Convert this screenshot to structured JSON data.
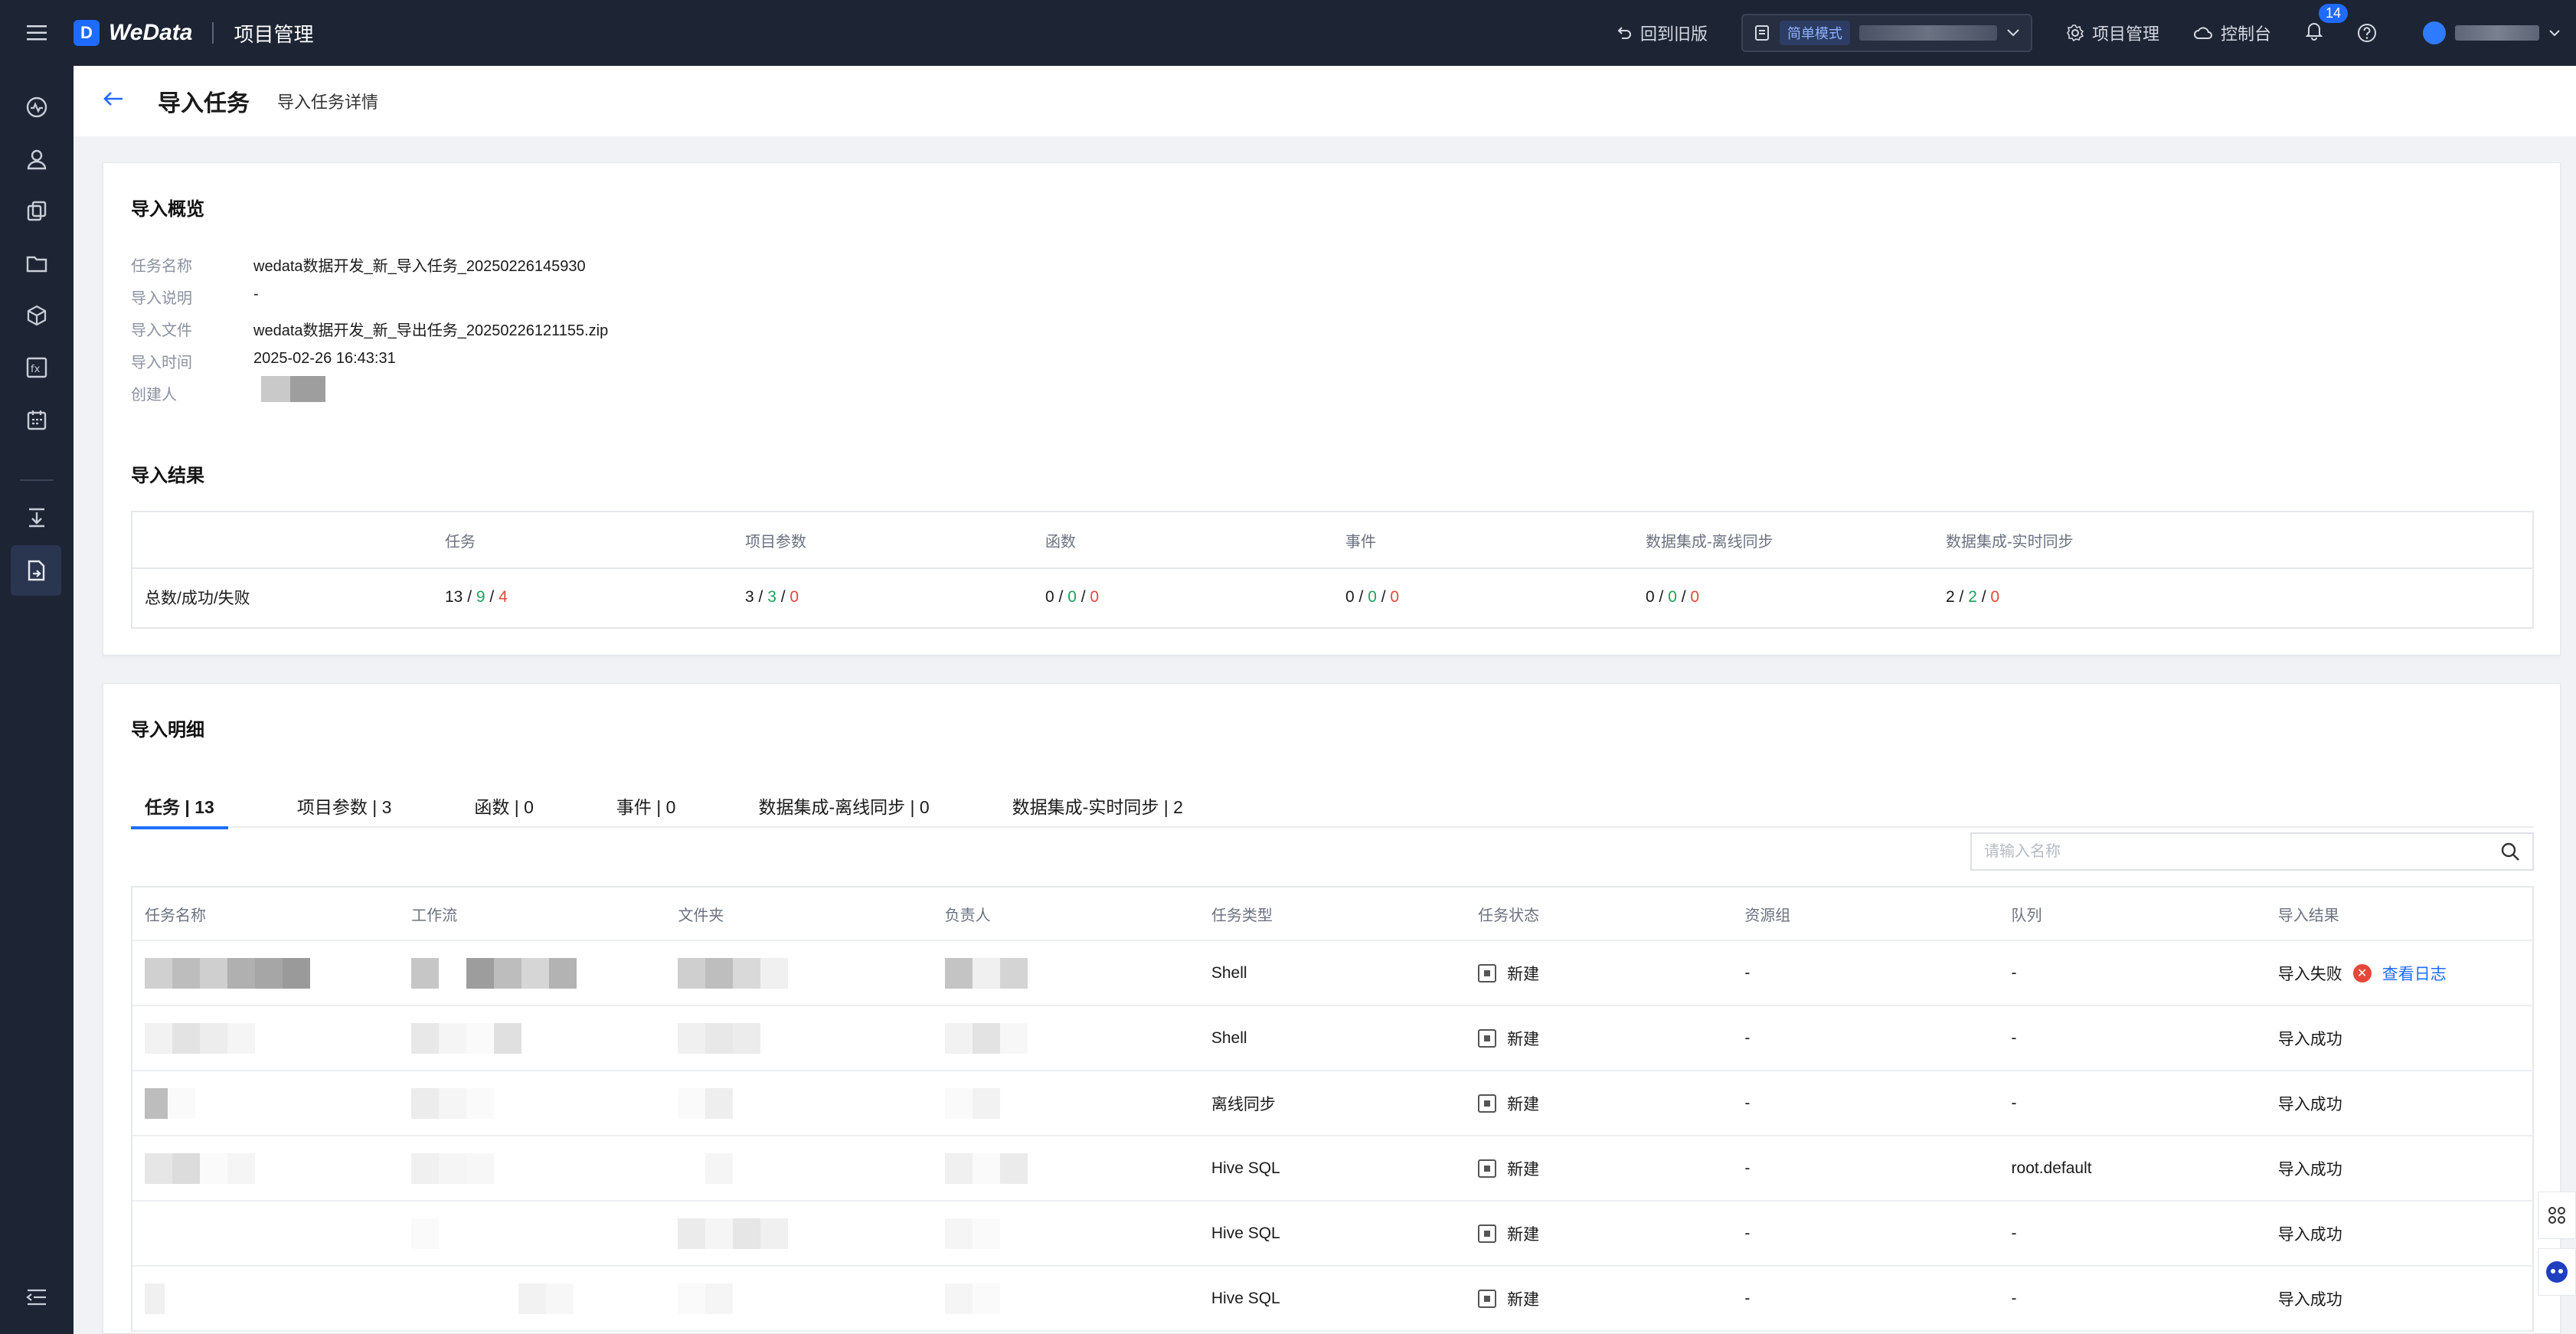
{
  "header": {
    "logo_text": "WeData",
    "logo_sub": "项目管理",
    "back_old": "回到旧版",
    "mode_tag": "简单模式",
    "project_mgmt": "项目管理",
    "console": "控制台",
    "notification_count": "14"
  },
  "page": {
    "title": "导入任务",
    "subtitle": "导入任务详情"
  },
  "overview": {
    "title": "导入概览",
    "fields": [
      {
        "label": "任务名称",
        "value": "wedata数据开发_新_导入任务_20250226145930"
      },
      {
        "label": "导入说明",
        "value": "-"
      },
      {
        "label": "导入文件",
        "value": "wedata数据开发_新_导出任务_20250226121155.zip"
      },
      {
        "label": "导入时间",
        "value": "2025-02-26 16:43:31"
      },
      {
        "label": "创建人",
        "value": ""
      }
    ]
  },
  "results": {
    "title": "导入结果",
    "row_label": "总数/成功/失败",
    "columns": [
      {
        "name": "任务",
        "total": "13",
        "success": "9",
        "fail": "4"
      },
      {
        "name": "项目参数",
        "total": "3",
        "success": "3",
        "fail": "0"
      },
      {
        "name": "函数",
        "total": "0",
        "success": "0",
        "fail": "0"
      },
      {
        "name": "事件",
        "total": "0",
        "success": "0",
        "fail": "0"
      },
      {
        "name": "数据集成-离线同步",
        "total": "0",
        "success": "0",
        "fail": "0"
      },
      {
        "name": "数据集成-实时同步",
        "total": "2",
        "success": "2",
        "fail": "0"
      }
    ]
  },
  "details": {
    "title": "导入明细",
    "tabs": [
      "任务 | 13",
      "项目参数 | 3",
      "函数 | 0",
      "事件 | 0",
      "数据集成-离线同步 | 0",
      "数据集成-实时同步 | 2"
    ],
    "search_placeholder": "请输入名称",
    "columns": [
      "任务名称",
      "工作流",
      "文件夹",
      "负责人",
      "任务类型",
      "任务状态",
      "资源组",
      "队列",
      "导入结果"
    ],
    "rows": [
      {
        "type": "Shell",
        "status": "新建",
        "resource": "-",
        "queue": "-",
        "result": "导入失败",
        "log": "查看日志"
      },
      {
        "type": "Shell",
        "status": "新建",
        "resource": "-",
        "queue": "-",
        "result": "导入成功",
        "log": ""
      },
      {
        "type": "离线同步",
        "status": "新建",
        "resource": "-",
        "queue": "-",
        "result": "导入成功",
        "log": ""
      },
      {
        "type": "Hive SQL",
        "status": "新建",
        "resource": "-",
        "queue": "root.default",
        "result": "导入成功",
        "log": ""
      },
      {
        "type": "Hive SQL",
        "status": "新建",
        "resource": "-",
        "queue": "-",
        "result": "导入成功",
        "log": ""
      },
      {
        "type": "Hive SQL",
        "status": "新建",
        "resource": "-",
        "queue": "-",
        "result": "导入成功",
        "log": ""
      }
    ]
  },
  "colors": {
    "accent": "#1f6bff",
    "success": "#19a35a",
    "fail": "#e5473a",
    "topbar": "#1d2433"
  }
}
